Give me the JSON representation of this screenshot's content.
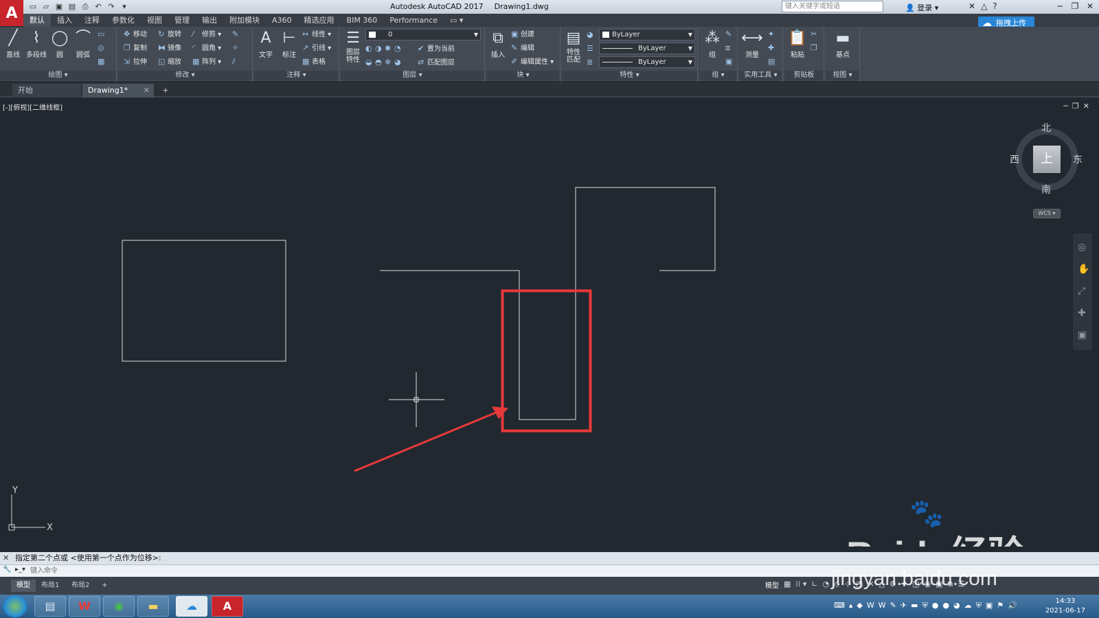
{
  "titlebar": {
    "app_name": "Autodesk AutoCAD 2017",
    "file_name": "Drawing1.dwg",
    "search_placeholder": "键入关键字或短语",
    "login": "登录",
    "upload_button": "拖拽上传"
  },
  "ribbon_tabs": [
    "默认",
    "插入",
    "注释",
    "参数化",
    "视图",
    "管理",
    "输出",
    "附加模块",
    "A360",
    "精选应用",
    "BIM 360",
    "Performance"
  ],
  "ribbon": {
    "draw": {
      "title": "绘图",
      "line": "直线",
      "polyline": "多段线",
      "circle": "圆",
      "arc": "圆弧"
    },
    "modify": {
      "title": "修改",
      "move": "移动",
      "rotate": "旋转",
      "trim": "修剪",
      "copy": "复制",
      "mirror": "镜像",
      "fillet": "圆角",
      "stretch": "拉伸",
      "scale": "缩放",
      "array": "阵列"
    },
    "annotation": {
      "title": "注释",
      "text": "文字",
      "dimension": "标注",
      "linear": "线性",
      "leader": "引线",
      "table": "表格"
    },
    "layers": {
      "title": "图层",
      "properties": "图层特性",
      "current_layer": "0",
      "make_current": "置为当前",
      "match_layer": "匹配图层"
    },
    "block": {
      "title": "块",
      "insert": "插入",
      "create": "创建",
      "edit": "编辑",
      "edit_attributes": "编辑属性"
    },
    "properties": {
      "title": "特性",
      "match": "特性匹配",
      "color": "ByLayer",
      "linetype": "ByLayer",
      "lineweight": "ByLayer"
    },
    "groups": {
      "title": "组",
      "group": "组"
    },
    "utilities": {
      "title": "实用工具",
      "measure": "测量"
    },
    "clipboard": {
      "title": "剪贴板",
      "paste": "粘贴"
    },
    "view": {
      "title": "视图",
      "base": "基点"
    }
  },
  "doc_tabs": {
    "start": "开始",
    "drawing": "Drawing1*"
  },
  "viewport": {
    "label": "[-][俯视][二维线框]",
    "viewcube": {
      "north": "北",
      "south": "南",
      "east": "东",
      "west": "西",
      "face": "上",
      "wcs": "WCS"
    },
    "ucs_x": "X",
    "ucs_y": "Y"
  },
  "command": {
    "history": "指定第二个点或 <使用第一个点作为位移>:",
    "placeholder": "键入命令"
  },
  "layout_tabs": [
    "模型",
    "布局1",
    "布局2"
  ],
  "status": {
    "model": "模型"
  },
  "clock": {
    "time": "14:33",
    "date": "2021-06-17"
  },
  "watermark": {
    "brand": "Baidu经验",
    "url": "jingyan.baidu.com"
  },
  "colors": {
    "canvas": "#212830",
    "highlight": "#e8393a",
    "ribbon": "#434a54"
  }
}
